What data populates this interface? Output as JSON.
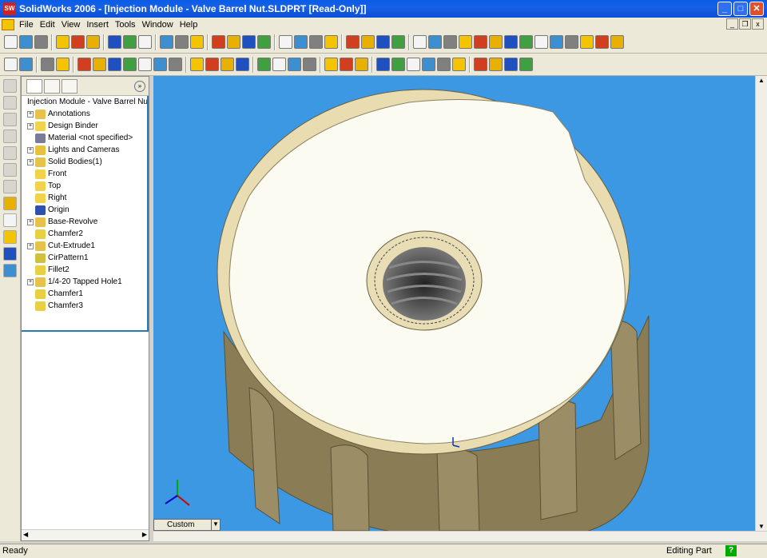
{
  "window": {
    "title": "SolidWorks 2006 - [Injection Module - Valve Barrel Nut.SLDPRT [Read-Only]]",
    "logo_text": "SW"
  },
  "menu": [
    "File",
    "Edit",
    "View",
    "Insert",
    "Tools",
    "Window",
    "Help"
  ],
  "tree": {
    "root": "Injection Module - Valve Barrel Nut",
    "items": [
      {
        "label": "Annotations",
        "expand": true,
        "icon": "annotations-icon",
        "color": "#e6c24a"
      },
      {
        "label": "Design Binder",
        "expand": true,
        "icon": "design-binder-icon",
        "color": "#f2d24a"
      },
      {
        "label": "Material <not specified>",
        "expand": false,
        "icon": "material-icon",
        "color": "#7a7a9a"
      },
      {
        "label": "Lights and Cameras",
        "expand": true,
        "icon": "lights-icon",
        "color": "#e8c040"
      },
      {
        "label": "Solid Bodies(1)",
        "expand": true,
        "icon": "solid-bodies-icon",
        "color": "#e6c24a"
      },
      {
        "label": "Front",
        "expand": false,
        "icon": "plane-icon",
        "color": "#f2d24a"
      },
      {
        "label": "Top",
        "expand": false,
        "icon": "plane-icon",
        "color": "#f2d24a"
      },
      {
        "label": "Right",
        "expand": false,
        "icon": "plane-icon",
        "color": "#f2d24a"
      },
      {
        "label": "Origin",
        "expand": false,
        "icon": "origin-icon",
        "color": "#3050b0"
      },
      {
        "label": "Base-Revolve",
        "expand": true,
        "icon": "revolve-icon",
        "color": "#e6c24a"
      },
      {
        "label": "Chamfer2",
        "expand": false,
        "icon": "chamfer-icon",
        "color": "#e8d040"
      },
      {
        "label": "Cut-Extrude1",
        "expand": true,
        "icon": "cut-extrude-icon",
        "color": "#e6c24a"
      },
      {
        "label": "CirPattern1",
        "expand": false,
        "icon": "pattern-icon",
        "color": "#d0c040"
      },
      {
        "label": "Fillet2",
        "expand": false,
        "icon": "fillet-icon",
        "color": "#e8d040"
      },
      {
        "label": "1/4-20 Tapped Hole1",
        "expand": true,
        "icon": "hole-icon",
        "color": "#e6c24a"
      },
      {
        "label": "Chamfer1",
        "expand": false,
        "icon": "chamfer-icon",
        "color": "#e8d040"
      },
      {
        "label": "Chamfer3",
        "expand": false,
        "icon": "chamfer-icon",
        "color": "#e8d040"
      }
    ]
  },
  "view": {
    "orientation": "Custom"
  },
  "status": {
    "left": "Ready",
    "mode": "Editing Part",
    "help_glyph": "?"
  },
  "colors": {
    "viewport_bg": "#3c98e2",
    "part_face": "#fbfbf2",
    "part_side": "#8a7d56",
    "tree_line": "#2a7ab8"
  }
}
